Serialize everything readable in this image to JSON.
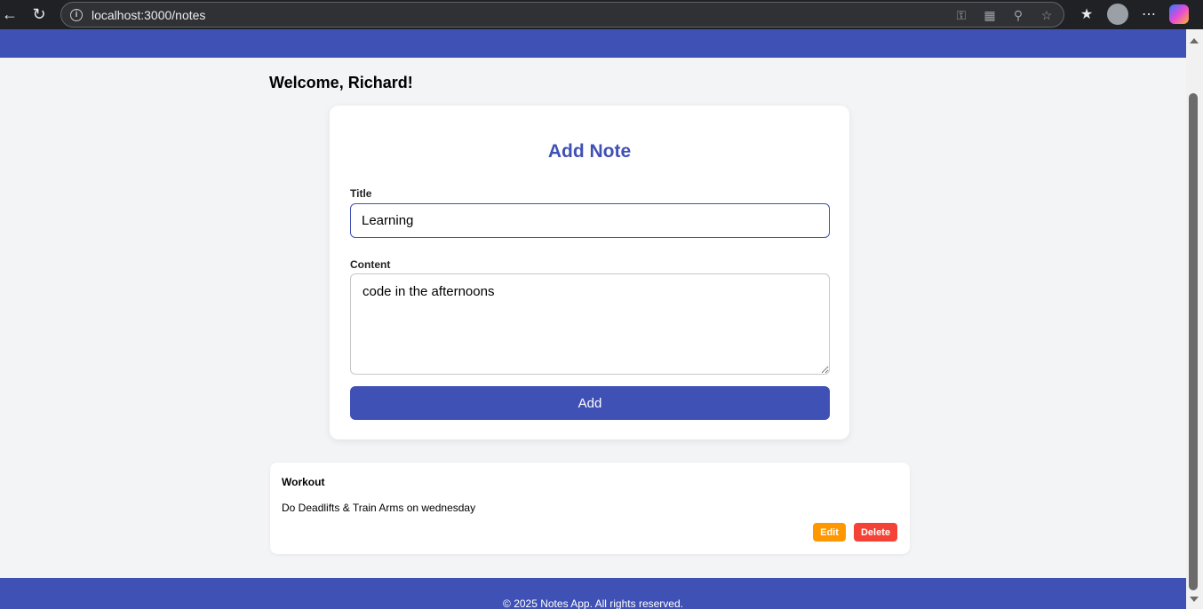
{
  "browser": {
    "url": "localhost:3000/notes",
    "icons": [
      "back-arrow-icon",
      "reload-icon",
      "info-icon",
      "key-icon",
      "apps-icon",
      "zoom-icon",
      "star-icon",
      "favorites-icon",
      "profile-icon",
      "more-icon",
      "copilot-icon"
    ]
  },
  "colors": {
    "primary": "#3f51b5",
    "edit": "#ff9800",
    "delete": "#f44336",
    "background": "#f3f4f6"
  },
  "page": {
    "welcome": "Welcome, Richard!"
  },
  "form": {
    "heading": "Add Note",
    "title_label": "Title",
    "title_value": "Learning",
    "content_label": "Content",
    "content_value": "code in the afternoons",
    "add_label": "Add"
  },
  "notes": [
    {
      "title": "Workout",
      "content": "Do Deadlifts & Train Arms on wednesday",
      "edit_label": "Edit",
      "delete_label": "Delete"
    }
  ],
  "footer": {
    "text": "© 2025 Notes App. All rights reserved."
  }
}
